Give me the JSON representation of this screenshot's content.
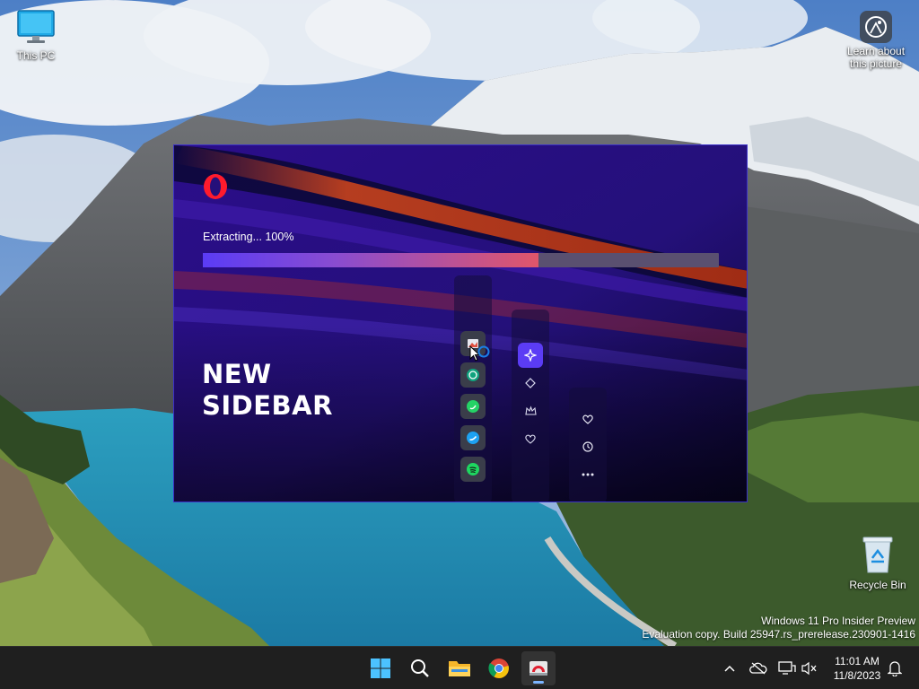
{
  "desktop": {
    "icons": {
      "this_pc": "This PC",
      "learn_line1": "Learn about",
      "learn_line2": "this picture",
      "recycle_bin": "Recycle Bin"
    },
    "watermark": {
      "line1": "Windows 11 Pro Insider Preview",
      "line2": "Evaluation copy. Build 25947.rs_prerelease.230901-1416"
    }
  },
  "installer": {
    "status": "Extracting... 100%",
    "progress": 0.65,
    "headline_line1": "NEW",
    "headline_line2": "SIDEBAR",
    "sidebar_col1": [
      "picture-icon",
      "chatgpt-icon",
      "whatsapp-icon",
      "twitter-icon",
      "spotify-icon"
    ],
    "sidebar_col2": [
      "aria-icon",
      "diamond-icon",
      "crown-icon",
      "heart-outline-icon"
    ],
    "sidebar_col3": [
      "heart-icon",
      "clock-icon",
      "more-icon"
    ]
  },
  "taskbar": {
    "apps": [
      "start-icon",
      "search-icon",
      "file-explorer-icon",
      "chrome-icon",
      "opera-installer-icon"
    ],
    "time": "11:01 AM",
    "date": "11/8/2023"
  },
  "colors": {
    "accent": "#5b3cf5",
    "installer_bg": "#2a1080",
    "taskbar_bg": "#1f1f1f"
  }
}
